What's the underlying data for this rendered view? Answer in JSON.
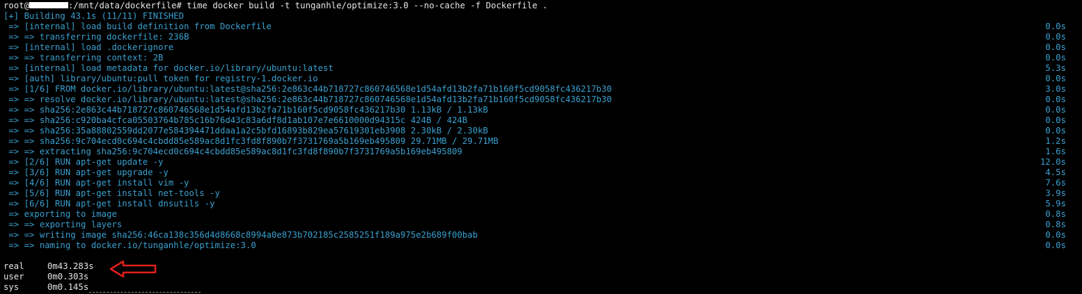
{
  "prompt": {
    "user": "root@",
    "host_tail": ":/mnt/data/dockerfile#",
    "command": " time docker build -t tunganhle/optimize:3.0 --no-cache -f Dockerfile ."
  },
  "status_line": "[+] Building 43.1s (11/11) FINISHED",
  "build_lines": [
    {
      "text": " => [internal] load build definition from Dockerfile",
      "dur": "0.0s"
    },
    {
      "text": " => => transferring dockerfile: 236B",
      "dur": "0.0s"
    },
    {
      "text": " => [internal] load .dockerignore",
      "dur": "0.0s"
    },
    {
      "text": " => => transferring context: 2B",
      "dur": "0.0s"
    },
    {
      "text": " => [internal] load metadata for docker.io/library/ubuntu:latest",
      "dur": "5.3s"
    },
    {
      "text": " => [auth] library/ubuntu:pull token for registry-1.docker.io",
      "dur": "0.0s"
    },
    {
      "text": " => [1/6] FROM docker.io/library/ubuntu:latest@sha256:2e863c44b718727c860746568e1d54afd13b2fa71b160f5cd9058fc436217b30",
      "dur": "3.0s"
    },
    {
      "text": " => => resolve docker.io/library/ubuntu:latest@sha256:2e863c44b718727c860746568e1d54afd13b2fa71b160f5cd9058fc436217b30",
      "dur": "0.0s"
    },
    {
      "text": " => => sha256:2e863c44b718727c860746568e1d54afd13b2fa71b160f5cd9058fc436217b30 1.13kB / 1.13kB",
      "dur": "0.0s"
    },
    {
      "text": " => => sha256:c920ba4cfca05503764b785c16b76d43c83a6df8d1ab107e7e6610000d94315c 424B / 424B",
      "dur": "0.0s"
    },
    {
      "text": " => => sha256:35a88802559dd2077e584394471ddaa1a2c5bfd16893b829ea57619301eb3908 2.30kB / 2.30kB",
      "dur": "0.0s"
    },
    {
      "text": " => => sha256:9c704ecd0c694c4cbdd85e589ac8d1fc3fd8f890b7f3731769a5b169eb495809 29.71MB / 29.71MB",
      "dur": "1.2s"
    },
    {
      "text": " => => extracting sha256:9c704ecd0c694c4cbdd85e589ac8d1fc3fd8f890b7f3731769a5b169eb495809",
      "dur": "1.6s"
    },
    {
      "text": " => [2/6] RUN apt-get update -y",
      "dur": "12.0s"
    },
    {
      "text": " => [3/6] RUN apt-get upgrade -y",
      "dur": "4.5s"
    },
    {
      "text": " => [4/6] RUN apt-get install vim -y",
      "dur": "7.6s"
    },
    {
      "text": " => [5/6] RUN apt-get install net-tools -y",
      "dur": "3.9s"
    },
    {
      "text": " => [6/6] RUN apt-get install dnsutils -y",
      "dur": "5.9s"
    },
    {
      "text": " => exporting to image",
      "dur": "0.8s"
    },
    {
      "text": " => => exporting layers",
      "dur": "0.8s"
    },
    {
      "text": " => => writing image sha256:46ca138c356d4d8668c8994a0e873b702185c2585251f189a975e2b689f00bab",
      "dur": "0.0s"
    },
    {
      "text": " => => naming to docker.io/tunganhle/optimize:3.0",
      "dur": "0.0s"
    }
  ],
  "timing": [
    {
      "label": "real",
      "value": "0m43.283s"
    },
    {
      "label": "user",
      "value": "0m0.303s"
    },
    {
      "label": "sys",
      "value": "0m0.145s"
    }
  ],
  "colors": {
    "background": "#000000",
    "text": "#e6e6e6",
    "docker_output": "#3aa0d0",
    "annotation_arrow": "#e0201c",
    "redaction": "#ffffff"
  },
  "icons": {
    "annotation": "red-arrow-left-icon"
  }
}
